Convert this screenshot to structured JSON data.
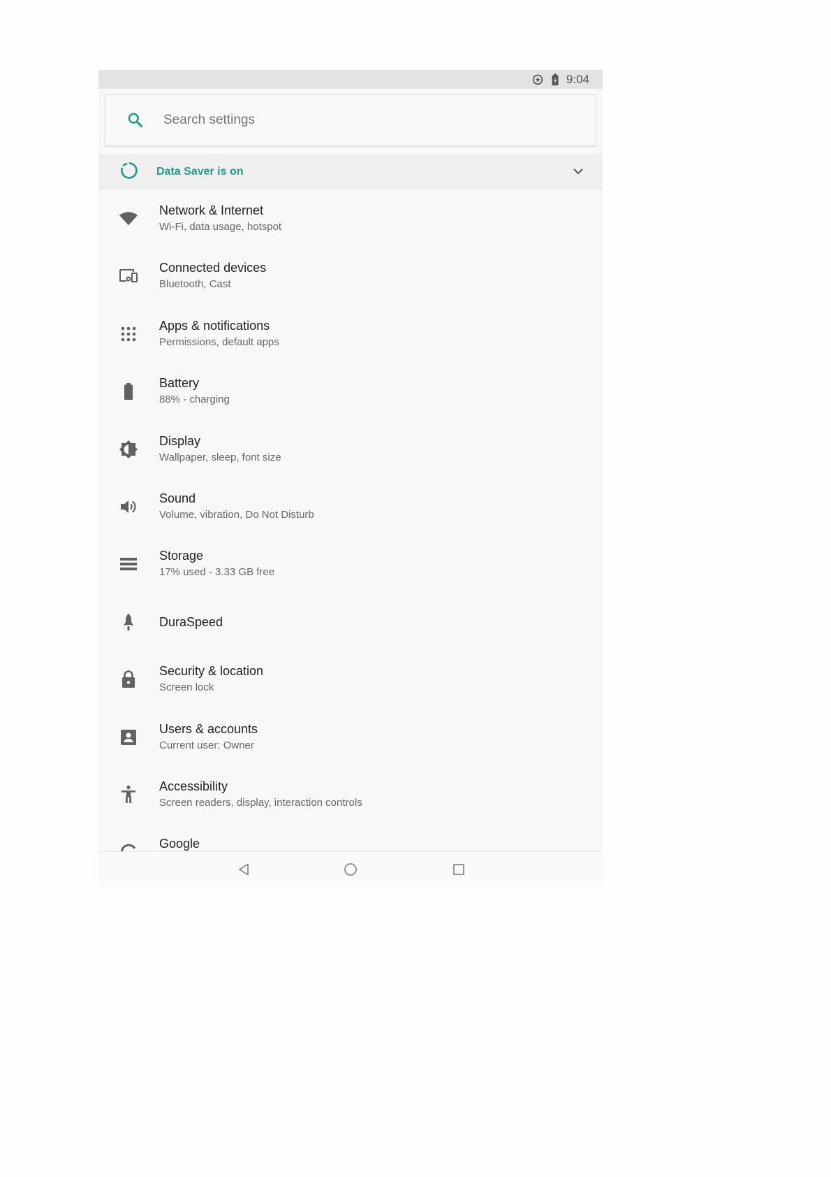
{
  "status_bar": {
    "time": "9:04",
    "icons": [
      "data-saver-status-icon",
      "battery-charging-icon"
    ]
  },
  "search": {
    "placeholder": "Search settings",
    "icon": "search-icon"
  },
  "data_saver": {
    "label": "Data Saver is on",
    "icon": "data-saver-icon",
    "expand_icon": "chevron-down-icon"
  },
  "settings": {
    "items": [
      {
        "title": "Network & Internet",
        "subtitle": "Wi-Fi, data usage, hotspot",
        "icon": "wifi-icon"
      },
      {
        "title": "Connected devices",
        "subtitle": "Bluetooth, Cast",
        "icon": "devices-icon"
      },
      {
        "title": "Apps & notifications",
        "subtitle": "Permissions, default apps",
        "icon": "apps-grid-icon"
      },
      {
        "title": "Battery",
        "subtitle": "88% - charging",
        "icon": "battery-icon"
      },
      {
        "title": "Display",
        "subtitle": "Wallpaper, sleep, font size",
        "icon": "brightness-icon"
      },
      {
        "title": "Sound",
        "subtitle": "Volume, vibration, Do Not Disturb",
        "icon": "volume-icon"
      },
      {
        "title": "Storage",
        "subtitle": "17% used - 3.33 GB free",
        "icon": "storage-icon"
      },
      {
        "title": "DuraSpeed",
        "subtitle": "",
        "icon": "rocket-icon"
      },
      {
        "title": "Security & location",
        "subtitle": "Screen lock",
        "icon": "lock-icon"
      },
      {
        "title": "Users & accounts",
        "subtitle": "Current user: Owner",
        "icon": "account-box-icon"
      },
      {
        "title": "Accessibility",
        "subtitle": "Screen readers, display, interaction controls",
        "icon": "accessibility-icon"
      },
      {
        "title": "Google",
        "subtitle": "",
        "icon": "google-icon"
      }
    ]
  },
  "nav_bar": {
    "buttons": [
      "back-icon",
      "home-icon",
      "recents-icon"
    ]
  },
  "colors": {
    "accent": "#1e9d8b",
    "icon_gray": "#616161",
    "status_bar_bg": "#e3e3e3",
    "page_bg": "#f8f8f8"
  }
}
